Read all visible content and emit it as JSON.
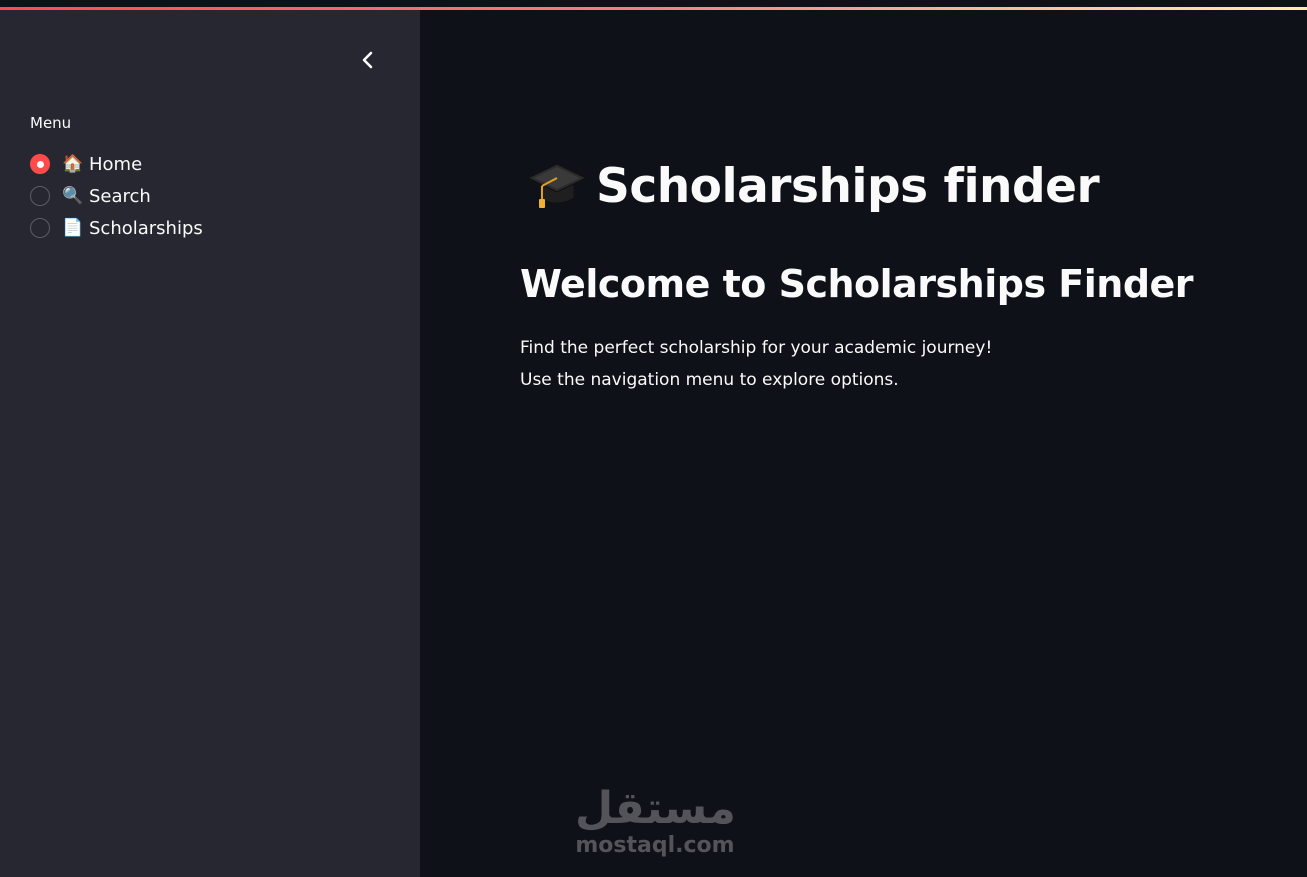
{
  "sidebar": {
    "menu_label": "Menu",
    "options": [
      {
        "icon": "🏠",
        "label": "Home",
        "selected": true
      },
      {
        "icon": "🔍",
        "label": "Search",
        "selected": false
      },
      {
        "icon": "📄",
        "label": "Scholarships",
        "selected": false
      }
    ]
  },
  "main": {
    "title": "Scholarships finder",
    "welcome_heading": "Welcome to Scholarships Finder",
    "line1": "Find the perfect scholarship for your academic journey!",
    "line2": "Use the navigation menu to explore options."
  },
  "watermark": {
    "arabic": "مستقل",
    "latin": "mostaql.com"
  },
  "colors": {
    "accent": "#ff4b4b",
    "sidebar_bg": "#262730",
    "main_bg": "#0e1117",
    "text": "#fafafa"
  }
}
